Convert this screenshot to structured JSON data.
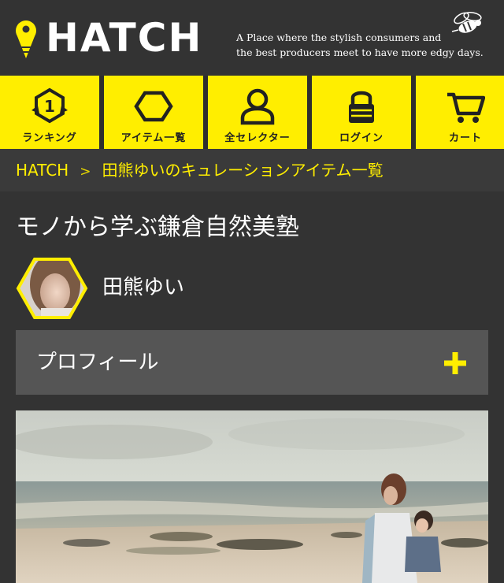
{
  "header": {
    "logo_text": "HATCH",
    "tagline_line1": "A Place where the stylish consumers and",
    "tagline_line2": "the best producers meet to have more edgy days.",
    "brand_color": "#ffee00",
    "icons": [
      "map-pin-logo-icon",
      "bee-icon"
    ]
  },
  "nav": {
    "items": [
      {
        "label": "ランキング",
        "icon": "ranking-icon"
      },
      {
        "label": "アイテム一覧",
        "icon": "hexagon-icon"
      },
      {
        "label": "全セレクター",
        "icon": "person-icon"
      },
      {
        "label": "ログイン",
        "icon": "lock-icon"
      },
      {
        "label": "カート",
        "icon": "cart-icon"
      }
    ],
    "rank_number": "1"
  },
  "breadcrumb": {
    "home": "HATCH",
    "separator": ">",
    "current": "田熊ゆいのキュレーションアイテム一覧"
  },
  "main": {
    "page_title": "モノから学ぶ鎌倉自然美塾",
    "curator_name": "田熊ゆい",
    "profile_label": "プロフィール",
    "profile_icon": "plus-icon"
  },
  "colors": {
    "background": "#333333",
    "accent": "#ffee00",
    "panel": "#555555"
  }
}
